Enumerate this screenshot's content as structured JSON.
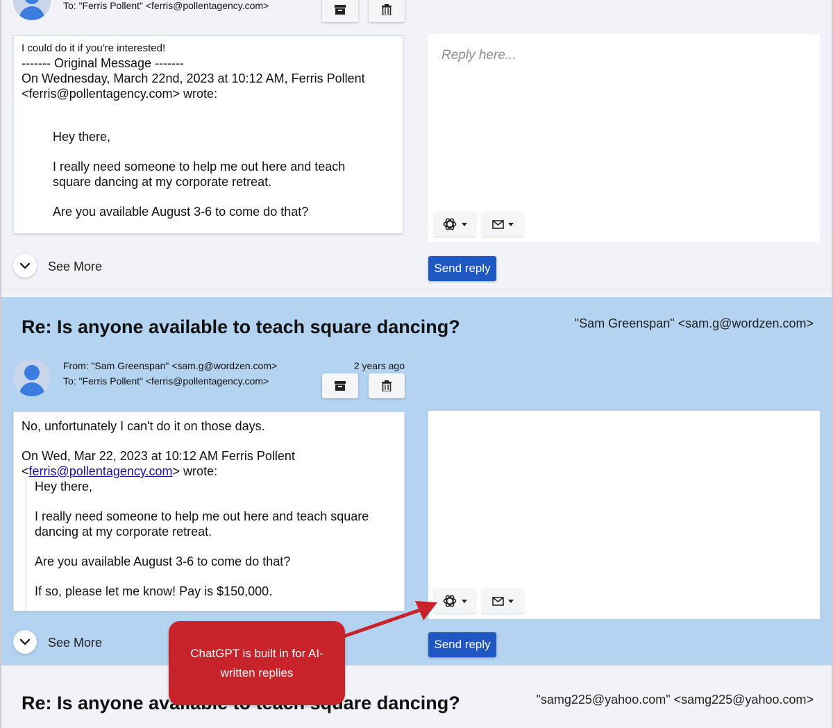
{
  "thread": [
    {
      "to": "To: \"Ferris Pollent\" <ferris@pollentagency.com>",
      "message_lines": [
        "I could do it if you're interested!",
        "------- Original Message -------",
        "On Wednesday, March 22nd, 2023 at 10:12 AM, Ferris Pollent",
        "<ferris@pollentagency.com> wrote:",
        "Hey there,",
        "I really need someone to help me out here and teach",
        "square dancing at my corporate retreat.",
        "Are you available August 3-6 to come do that?"
      ],
      "reply_placeholder": "Reply here...",
      "send_label": "Send reply",
      "see_more_label": "See More"
    },
    {
      "subject": "Re: Is anyone available to teach square dancing?",
      "sender": "\"Sam Greenspan\" <sam.g@wordzen.com>",
      "from": "From: \"Sam Greenspan\" <sam.g@wordzen.com>",
      "to": "To: \"Ferris Pollent\" <ferris@pollentagency.com>",
      "time": "2 years ago",
      "message": {
        "line1": "No, unfortunately I can't do it on those days.",
        "line2": "On Wed, Mar 22, 2023 at 10:12 AM Ferris Pollent",
        "link_prefix": "<",
        "link_text": "ferris@pollentagency.com",
        "link_suffix": "> wrote:",
        "quote": [
          "Hey there,",
          "I really need someone to help me out here and teach square",
          "dancing at my corporate retreat.",
          "Are you available August 3-6 to come do that?",
          "If so, please let me know! Pay is $150,000."
        ]
      },
      "send_label": "Send reply",
      "see_more_label": "See More"
    },
    {
      "subject": "Re: Is anyone available to teach square dancing?",
      "sender": "\"samg225@yahoo.com\" <samg225@yahoo.com>"
    }
  ],
  "annotation": {
    "callout_text": "ChatGPT is built in for AI-written replies",
    "callout_color": "#c8222a"
  },
  "icons": {
    "archive": "archive-icon",
    "delete": "trash-icon",
    "chatgpt": "chatgpt-icon",
    "email": "envelope-icon",
    "expand": "chevron-down-icon"
  },
  "colors": {
    "selected_thread_bg": "#b3d3f1",
    "send_button": "#1f57c3",
    "link": "#1a0dab"
  }
}
